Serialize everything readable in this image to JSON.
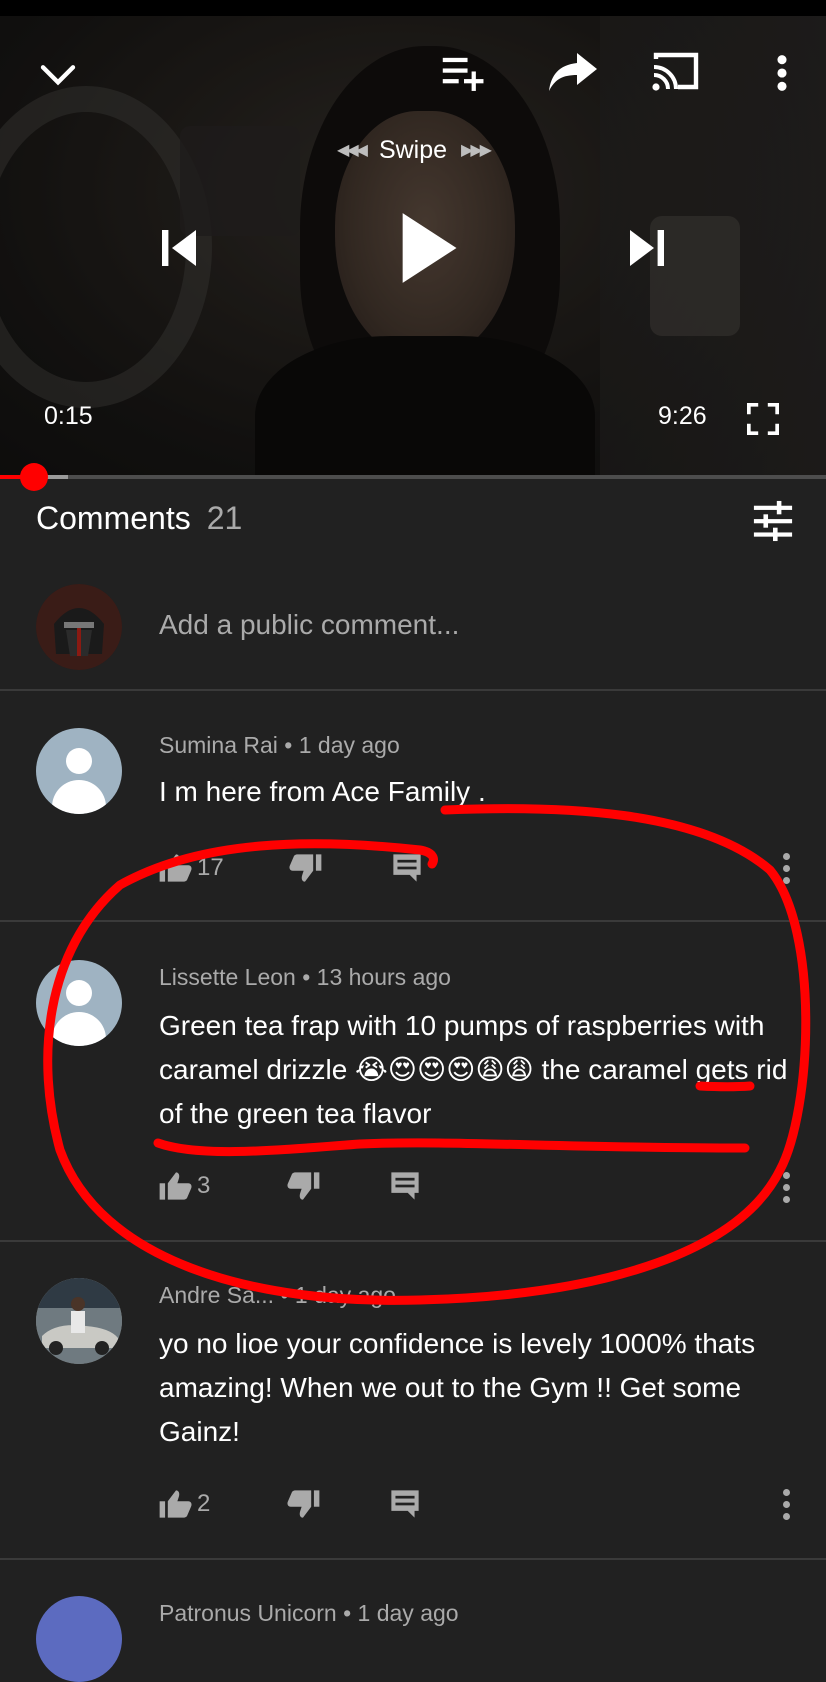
{
  "player": {
    "swipe_label": "Swipe",
    "current_time": "0:15",
    "duration": "9:26",
    "progress_fraction": 0.027
  },
  "comments_header": {
    "title": "Comments",
    "count": "21"
  },
  "add_comment": {
    "placeholder": "Add a public comment..."
  },
  "comments": [
    {
      "author": "Sumina Rai",
      "time": "1 day ago",
      "text": "I m here from Ace Family .",
      "likes": "17"
    },
    {
      "author": "Lissette Leon",
      "time": "13 hours ago",
      "text": "Green tea frap with 10 pumps of raspberries with caramel drizzle 😭😍😍😍😩😩 the caramel gets rid of the green tea flavor",
      "likes": "3"
    },
    {
      "author": "Andre Sa...",
      "time": "1 day ago",
      "text": "yo no lioe your confidence is levely 1000% thats amazing! When we out to the Gym !! Get some Gainz!",
      "likes": "2"
    },
    {
      "author": "Patronus Unicorn",
      "time": "1 day ago"
    }
  ],
  "colors": {
    "background": "#212121",
    "accent_red": "#ff0000",
    "secondary_text": "#aaaaaa",
    "annotation_red": "#ff0000"
  },
  "icons": [
    "collapse-chevron-icon",
    "add-to-queue-icon",
    "share-icon",
    "cast-icon",
    "more-vert-icon",
    "previous-icon",
    "play-icon",
    "next-icon",
    "fullscreen-icon",
    "filter-icon",
    "thumb-up-icon",
    "thumb-down-icon",
    "reply-icon"
  ]
}
